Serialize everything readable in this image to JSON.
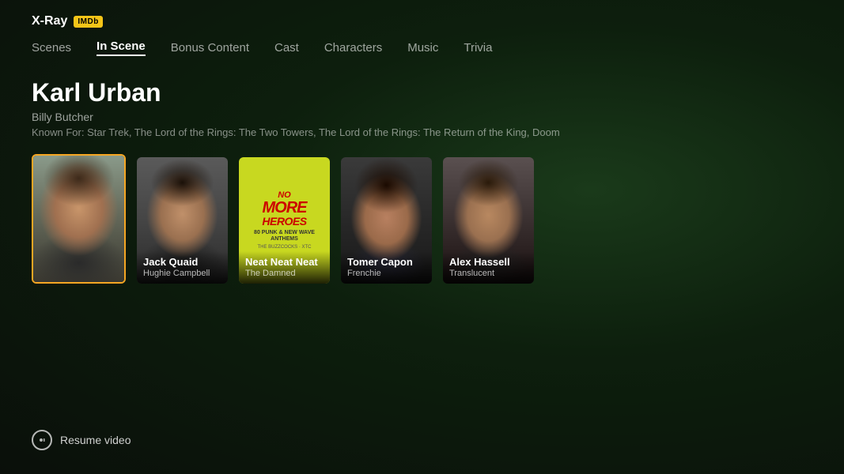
{
  "header": {
    "xray_label": "X-Ray",
    "imdb_label": "IMDb"
  },
  "nav": {
    "items": [
      {
        "id": "scenes",
        "label": "Scenes",
        "active": false
      },
      {
        "id": "in-scene",
        "label": "In Scene",
        "active": true
      },
      {
        "id": "bonus-content",
        "label": "Bonus Content",
        "active": false
      },
      {
        "id": "cast",
        "label": "Cast",
        "active": false
      },
      {
        "id": "characters",
        "label": "Characters",
        "active": false
      },
      {
        "id": "music",
        "label": "Music",
        "active": false
      },
      {
        "id": "trivia",
        "label": "Trivia",
        "active": false
      }
    ]
  },
  "actor": {
    "name": "Karl Urban",
    "role": "Billy Butcher",
    "known_for": "Known For: Star Trek, The Lord of the Rings: The Two Towers, The Lord of the Rings: The Return of the King, Doom"
  },
  "cards": [
    {
      "id": "karl-urban",
      "type": "portrait",
      "portrait_class": "portrait-karl",
      "selected": true,
      "show_label": false,
      "name": "",
      "role": ""
    },
    {
      "id": "jack-quaid",
      "type": "portrait",
      "portrait_class": "portrait-jack",
      "selected": false,
      "show_label": true,
      "name": "Jack Quaid",
      "role": "Hughie Campbell"
    },
    {
      "id": "neat-neat-neat",
      "type": "music",
      "selected": false,
      "show_label": true,
      "album_title": "No More Heroes",
      "album_line1": "No",
      "album_line2": "More",
      "album_line3": "Heroes",
      "album_sub": "80 Punk & New Wave Anthems",
      "name": "Neat Neat Neat",
      "role": "The Damned"
    },
    {
      "id": "tomer-capon",
      "type": "portrait",
      "portrait_class": "portrait-tomer",
      "selected": false,
      "show_label": true,
      "name": "Tomer Capon",
      "role": "Frenchie"
    },
    {
      "id": "alex-hassell",
      "type": "portrait",
      "portrait_class": "portrait-alex",
      "selected": false,
      "show_label": true,
      "name": "Alex Hassell",
      "role": "Translucent"
    }
  ],
  "resume": {
    "label": "Resume video"
  }
}
